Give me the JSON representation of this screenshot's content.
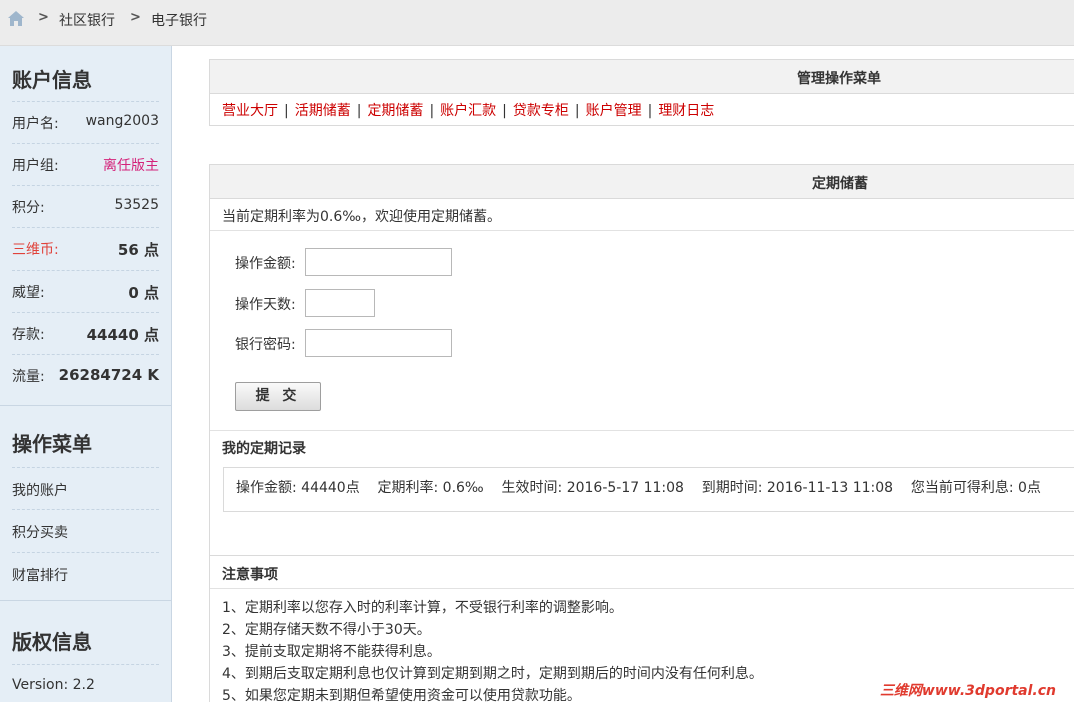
{
  "breadcrumb": {
    "items": [
      "社区银行",
      "电子银行"
    ],
    "separator": ">"
  },
  "sidebar": {
    "account_title": "账户信息",
    "account_rows": [
      {
        "label": "用户名:",
        "value": "wang2003"
      },
      {
        "label": "用户组:",
        "value": "离任版主"
      },
      {
        "label": "积分:",
        "value": "53525"
      },
      {
        "label": "三维币:",
        "value": "56 点"
      },
      {
        "label": "威望:",
        "value": "0 点"
      },
      {
        "label": "存款:",
        "value": "44440 点"
      },
      {
        "label": "流量:",
        "value": "26284724 K"
      }
    ],
    "menu_title": "操作菜单",
    "menu_items": [
      "我的账户",
      "积分买卖",
      "财富排行"
    ],
    "copyright_title": "版权信息",
    "version": "Version: 2.2"
  },
  "main": {
    "menu_panel_title": "管理操作菜单",
    "menu_links": [
      "营业大厅",
      "活期储蓄",
      "定期储蓄",
      "账户汇款",
      "贷款专柜",
      "账户管理",
      "理财日志"
    ],
    "menu_separator": "|",
    "fixed_panel_title": "定期储蓄",
    "rate_text": "当前定期利率为0.6‰，欢迎使用定期储蓄。",
    "form": {
      "amount_label": "操作金额:",
      "days_label": "操作天数:",
      "password_label": "银行密码:",
      "submit_label": "提 交"
    },
    "records_title": "我的定期记录",
    "record_text": "操作金额: 44440点    定期利率: 0.6‰    生效时间: 2016-5-17 11:08    到期时间: 2016-11-13 11:08    您当前可得利息: 0点",
    "notes_title": "注意事项",
    "notes": [
      "1、定期利率以您存入时的利率计算，不受银行利率的调整影响。",
      "2、定期存储天数不得小于30天。",
      "3、提前支取定期将不能获得利息。",
      "4、到期后支取定期利息也仅计算到定期到期之时，定期到期后的时间内没有任何利息。",
      "5、如果您定期未到期但希望使用资金可以使用贷款功能。"
    ]
  },
  "watermark": "三维网www.3dportal.cn",
  "colors": {
    "link_red": "#cc0000",
    "sidebar_bg": "#e5eef6",
    "accent_pink": "#d4237a",
    "accent_red": "#e0423b"
  }
}
